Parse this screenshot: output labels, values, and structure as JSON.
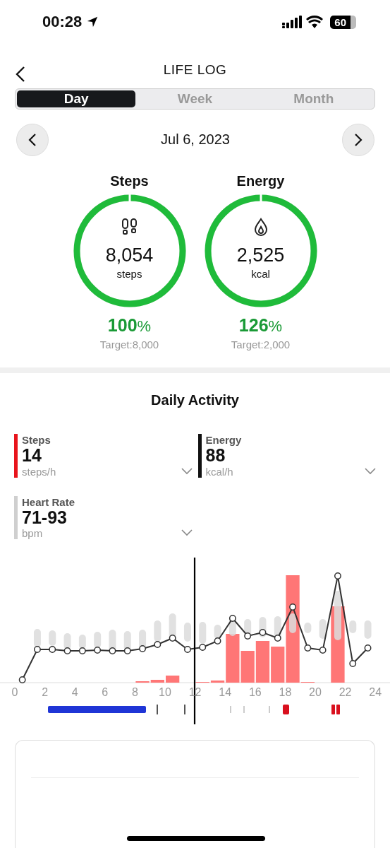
{
  "status_bar": {
    "time": "00:28",
    "battery": "60"
  },
  "header": {
    "title": "LIFE LOG"
  },
  "tabs": [
    {
      "label": "Day",
      "selected": true
    },
    {
      "label": "Week",
      "selected": false
    },
    {
      "label": "Month",
      "selected": false
    }
  ],
  "date": "Jul 6, 2023",
  "rings": [
    {
      "kind": "steps",
      "title": "Steps",
      "value": "8,054",
      "unit": "steps",
      "level": 1,
      "percent": "100",
      "percent_sign": "%",
      "target": "Target:8,000"
    },
    {
      "kind": "energy",
      "title": "Energy",
      "value": "2,525",
      "unit": "kcal",
      "level": 1,
      "percent": "126",
      "percent_sign": "%",
      "target": "Target:2,000"
    }
  ],
  "daily_activity": {
    "title": "Daily Activity",
    "metrics": [
      {
        "name": "Steps",
        "value": "14",
        "unit": "steps/h",
        "color": "#e8141c"
      },
      {
        "name": "Energy",
        "value": "88",
        "unit": "kcal/h",
        "color": "#111111"
      },
      {
        "name": "Heart Rate",
        "value": "71-93",
        "unit": "bpm",
        "color": "#cfcfcf"
      }
    ],
    "x_axis_labels": [
      "0",
      "2",
      "4",
      "6",
      "8",
      "10",
      "12",
      "14",
      "16",
      "18",
      "20",
      "22",
      "24"
    ]
  }
}
